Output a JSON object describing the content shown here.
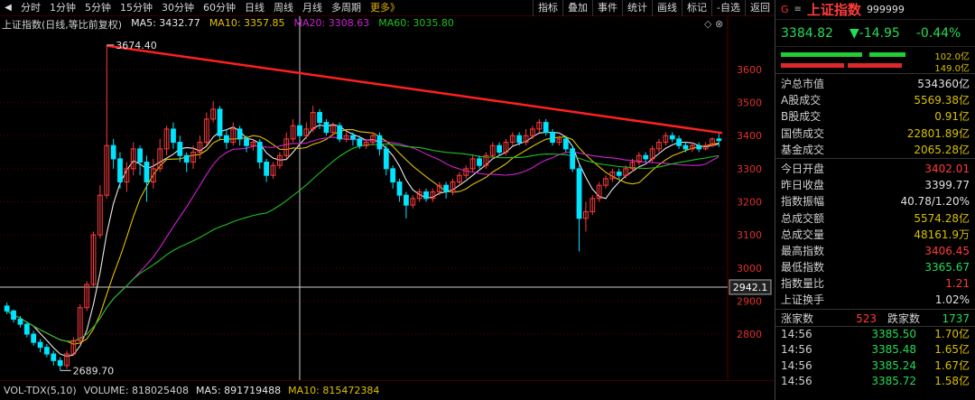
{
  "toolbar": {
    "back_icon": "back-arrow-icon",
    "periods": [
      "分时",
      "1分钟",
      "5分钟",
      "15分钟",
      "30分钟",
      "60分钟",
      "日线",
      "周线",
      "月线",
      "多周期"
    ],
    "more_label": "更多》",
    "tools": [
      "指标",
      "叠加",
      "事件",
      "统计",
      "画线",
      "标记",
      "-自选",
      "返回"
    ]
  },
  "chart_header": {
    "title": "上证指数(日线,等比前复权)",
    "ma5": "MA5: 3432.77",
    "ma10": "MA10: 3357.85",
    "ma20": "MA20: 3308.63",
    "ma60": "MA60: 3035.80",
    "ma5_color": "#e8e8e8",
    "ma10_color": "#e0c000",
    "ma20_color": "#d020d0",
    "ma60_color": "#20c020",
    "icons": "◇ ⊗"
  },
  "volume_header": {
    "title": "VOL-TDX(5,10)",
    "volume": "VOLUME: 818025408",
    "ma5": "MA5: 891719488",
    "ma10": "MA10: 815472384"
  },
  "chart_data": {
    "type": "candlestick",
    "title": "上证指数(日线,等比前复权)",
    "y_ticks": [
      2800,
      2900,
      3000,
      3100,
      3200,
      3300,
      3400,
      3500,
      3600
    ],
    "ylim": [
      2680,
      3690
    ],
    "annotations": {
      "high_label": "3674.40",
      "low_label": "2689.70",
      "current_marker": "2942.1",
      "crosshair_price": 2942.1
    },
    "trendline": {
      "from": 3672,
      "to": 3408,
      "color": "#ff2020"
    },
    "up_color": "#ff3b3b",
    "down_color": "#00e5ff",
    "candles": [
      [
        2885,
        2870,
        2895,
        2860
      ],
      [
        2870,
        2845,
        2875,
        2835
      ],
      [
        2845,
        2830,
        2855,
        2820
      ],
      [
        2830,
        2800,
        2835,
        2790
      ],
      [
        2800,
        2775,
        2810,
        2765
      ],
      [
        2775,
        2760,
        2785,
        2745
      ],
      [
        2760,
        2740,
        2770,
        2730
      ],
      [
        2740,
        2720,
        2750,
        2705
      ],
      [
        2720,
        2705,
        2730,
        2690
      ],
      [
        2705,
        2740,
        2750,
        2695
      ],
      [
        2740,
        2780,
        2790,
        2735
      ],
      [
        2780,
        2880,
        2890,
        2775
      ],
      [
        2880,
        2950,
        2960,
        2870
      ],
      [
        2950,
        3100,
        3110,
        2945
      ],
      [
        3100,
        3220,
        3250,
        3090
      ],
      [
        3220,
        3370,
        3674,
        3210
      ],
      [
        3370,
        3330,
        3390,
        3300
      ],
      [
        3330,
        3260,
        3350,
        3240
      ],
      [
        3260,
        3300,
        3320,
        3230
      ],
      [
        3300,
        3360,
        3380,
        3280
      ],
      [
        3360,
        3320,
        3370,
        3280
      ],
      [
        3320,
        3260,
        3340,
        3200
      ],
      [
        3260,
        3300,
        3330,
        3240
      ],
      [
        3300,
        3360,
        3390,
        3290
      ],
      [
        3360,
        3420,
        3430,
        3340
      ],
      [
        3420,
        3380,
        3440,
        3360
      ],
      [
        3380,
        3340,
        3400,
        3320
      ],
      [
        3340,
        3320,
        3350,
        3290
      ],
      [
        3320,
        3350,
        3370,
        3300
      ],
      [
        3350,
        3380,
        3400,
        3330
      ],
      [
        3380,
        3450,
        3470,
        3370
      ],
      [
        3450,
        3480,
        3505,
        3440
      ],
      [
        3480,
        3400,
        3490,
        3390
      ],
      [
        3400,
        3380,
        3420,
        3360
      ],
      [
        3380,
        3420,
        3440,
        3370
      ],
      [
        3420,
        3390,
        3430,
        3370
      ],
      [
        3390,
        3370,
        3400,
        3350
      ],
      [
        3370,
        3380,
        3390,
        3355
      ],
      [
        3380,
        3320,
        3390,
        3300
      ],
      [
        3320,
        3280,
        3330,
        3260
      ],
      [
        3280,
        3310,
        3320,
        3270
      ],
      [
        3310,
        3340,
        3350,
        3300
      ],
      [
        3340,
        3390,
        3410,
        3330
      ],
      [
        3390,
        3430,
        3450,
        3380
      ],
      [
        3430,
        3400,
        3440,
        3390
      ],
      [
        3400,
        3420,
        3440,
        3390
      ],
      [
        3420,
        3470,
        3490,
        3410
      ],
      [
        3470,
        3440,
        3480,
        3420
      ],
      [
        3440,
        3410,
        3450,
        3400
      ],
      [
        3410,
        3430,
        3440,
        3400
      ],
      [
        3430,
        3390,
        3440,
        3380
      ],
      [
        3390,
        3400,
        3410,
        3380
      ],
      [
        3400,
        3390,
        3410,
        3370
      ],
      [
        3390,
        3370,
        3400,
        3360
      ],
      [
        3370,
        3380,
        3390,
        3360
      ],
      [
        3380,
        3400,
        3410,
        3370
      ],
      [
        3400,
        3360,
        3410,
        3340
      ],
      [
        3360,
        3300,
        3370,
        3280
      ],
      [
        3300,
        3260,
        3310,
        3240
      ],
      [
        3260,
        3220,
        3270,
        3200
      ],
      [
        3220,
        3190,
        3230,
        3150
      ],
      [
        3190,
        3210,
        3220,
        3180
      ],
      [
        3210,
        3230,
        3240,
        3200
      ],
      [
        3230,
        3210,
        3240,
        3200
      ],
      [
        3210,
        3230,
        3240,
        3200
      ],
      [
        3230,
        3250,
        3260,
        3220
      ],
      [
        3250,
        3230,
        3260,
        3210
      ],
      [
        3230,
        3260,
        3270,
        3220
      ],
      [
        3260,
        3280,
        3290,
        3250
      ],
      [
        3280,
        3300,
        3310,
        3270
      ],
      [
        3300,
        3330,
        3340,
        3290
      ],
      [
        3330,
        3310,
        3340,
        3300
      ],
      [
        3310,
        3340,
        3350,
        3300
      ],
      [
        3340,
        3370,
        3380,
        3330
      ],
      [
        3370,
        3350,
        3380,
        3340
      ],
      [
        3350,
        3380,
        3390,
        3340
      ],
      [
        3380,
        3400,
        3410,
        3370
      ],
      [
        3400,
        3380,
        3410,
        3370
      ],
      [
        3380,
        3400,
        3420,
        3370
      ],
      [
        3400,
        3420,
        3430,
        3390
      ],
      [
        3420,
        3440,
        3450,
        3410
      ],
      [
        3440,
        3410,
        3450,
        3400
      ],
      [
        3410,
        3380,
        3420,
        3370
      ],
      [
        3380,
        3390,
        3400,
        3370
      ],
      [
        3390,
        3360,
        3400,
        3350
      ],
      [
        3360,
        3300,
        3370,
        3290
      ],
      [
        3300,
        3150,
        3310,
        3050
      ],
      [
        3150,
        3170,
        3200,
        3110
      ],
      [
        3170,
        3210,
        3220,
        3160
      ],
      [
        3210,
        3250,
        3260,
        3200
      ],
      [
        3250,
        3270,
        3280,
        3240
      ],
      [
        3270,
        3290,
        3300,
        3260
      ],
      [
        3290,
        3280,
        3300,
        3270
      ],
      [
        3280,
        3300,
        3310,
        3270
      ],
      [
        3300,
        3320,
        3330,
        3290
      ],
      [
        3320,
        3340,
        3350,
        3310
      ],
      [
        3340,
        3330,
        3350,
        3320
      ],
      [
        3330,
        3360,
        3370,
        3320
      ],
      [
        3360,
        3380,
        3390,
        3350
      ],
      [
        3380,
        3400,
        3410,
        3370
      ],
      [
        3400,
        3390,
        3410,
        3380
      ],
      [
        3390,
        3370,
        3400,
        3360
      ],
      [
        3370,
        3360,
        3380,
        3350
      ],
      [
        3360,
        3370,
        3380,
        3350
      ],
      [
        3370,
        3360,
        3380,
        3350
      ],
      [
        3360,
        3370,
        3380,
        3355
      ],
      [
        3370,
        3390,
        3395,
        3365
      ],
      [
        3390,
        3385,
        3406,
        3366
      ]
    ]
  },
  "right_panel": {
    "g_mark": "G",
    "menu_mark": "≡",
    "name": "上证指数",
    "code": "999999",
    "price": "3384.82",
    "change": "▼-14.95",
    "change_pct": "-0.44%",
    "bar1_val": "102.0亿",
    "bar2_val": "149.0亿",
    "stats": [
      {
        "label": "沪总市值",
        "value": "534360亿",
        "color": "#e0e0e0"
      },
      {
        "label": "A股成交",
        "value": "5569.38亿",
        "color": "#d8c000"
      },
      {
        "label": "B股成交",
        "value": "0.91亿",
        "color": "#d8c000"
      },
      {
        "label": "国债成交",
        "value": "22801.89亿",
        "color": "#d8c000"
      },
      {
        "label": "基金成交",
        "value": "2065.28亿",
        "color": "#d8c000"
      }
    ],
    "stats2": [
      {
        "label": "今日开盘",
        "value": "3402.01",
        "color": "#ff3b3b"
      },
      {
        "label": "昨日收盘",
        "value": "3399.77",
        "color": "#e0e0e0"
      },
      {
        "label": "指数振幅",
        "value": "40.78/1.20%",
        "color": "#e0e0e0"
      },
      {
        "label": "总成交额",
        "value": "5574.28亿",
        "color": "#d8c000"
      },
      {
        "label": "总成交量",
        "value": "48161.9万",
        "color": "#d8c000"
      },
      {
        "label": "最高指数",
        "value": "3406.45",
        "color": "#ff3b3b"
      },
      {
        "label": "最低指数",
        "value": "3365.67",
        "color": "#22dd55"
      },
      {
        "label": "指数量比",
        "value": "1.21",
        "color": "#ff3b3b"
      },
      {
        "label": "上证换手",
        "value": "1.02%",
        "color": "#e0e0e0"
      }
    ],
    "up_label": "涨家数",
    "up_count": "523",
    "down_label": "跌家数",
    "down_count": "1737",
    "ticks": [
      {
        "time": "14:56",
        "price": "3385.50",
        "vol": "1.70亿"
      },
      {
        "time": "14:56",
        "price": "3385.48",
        "vol": "1.65亿"
      },
      {
        "time": "14:56",
        "price": "3385.24",
        "vol": "1.67亿"
      },
      {
        "time": "14:56",
        "price": "3385.72",
        "vol": "1.58亿"
      }
    ]
  }
}
